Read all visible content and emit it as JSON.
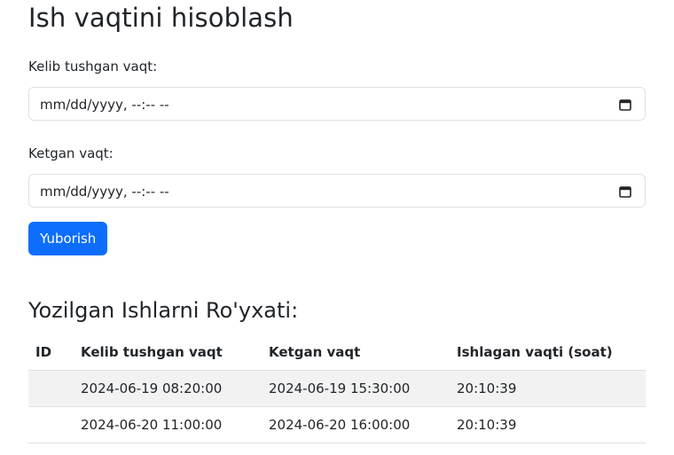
{
  "page": {
    "title": "Ish vaqtini hisoblash"
  },
  "form": {
    "arrival_label": "Kelib tushgan vaqt:",
    "arrival_value": "mm/dd/yyyy, --:-- --",
    "departure_label": "Ketgan vaqt:",
    "departure_value": "mm/dd/yyyy, --:-- --",
    "submit_label": "Yuborish",
    "calendar_icon": "calendar-icon"
  },
  "list": {
    "title": "Yozilgan Ishlarni Ro'yxati:",
    "headers": [
      "ID",
      "Kelib tushgan vaqt",
      "Ketgan vaqt",
      "Ishlagan vaqti (soat)"
    ],
    "rows": [
      {
        "id": "",
        "arrival": "2024-06-19 08:20:00",
        "departure": "2024-06-19 15:30:00",
        "worked": "20:10:39"
      },
      {
        "id": "",
        "arrival": "2024-06-20 11:00:00",
        "departure": "2024-06-20 16:00:00",
        "worked": "20:10:39"
      }
    ]
  },
  "colors": {
    "primary": "#0d6efd",
    "stripe": "#f2f2f2",
    "border": "#dee2e6",
    "text": "#212529"
  }
}
